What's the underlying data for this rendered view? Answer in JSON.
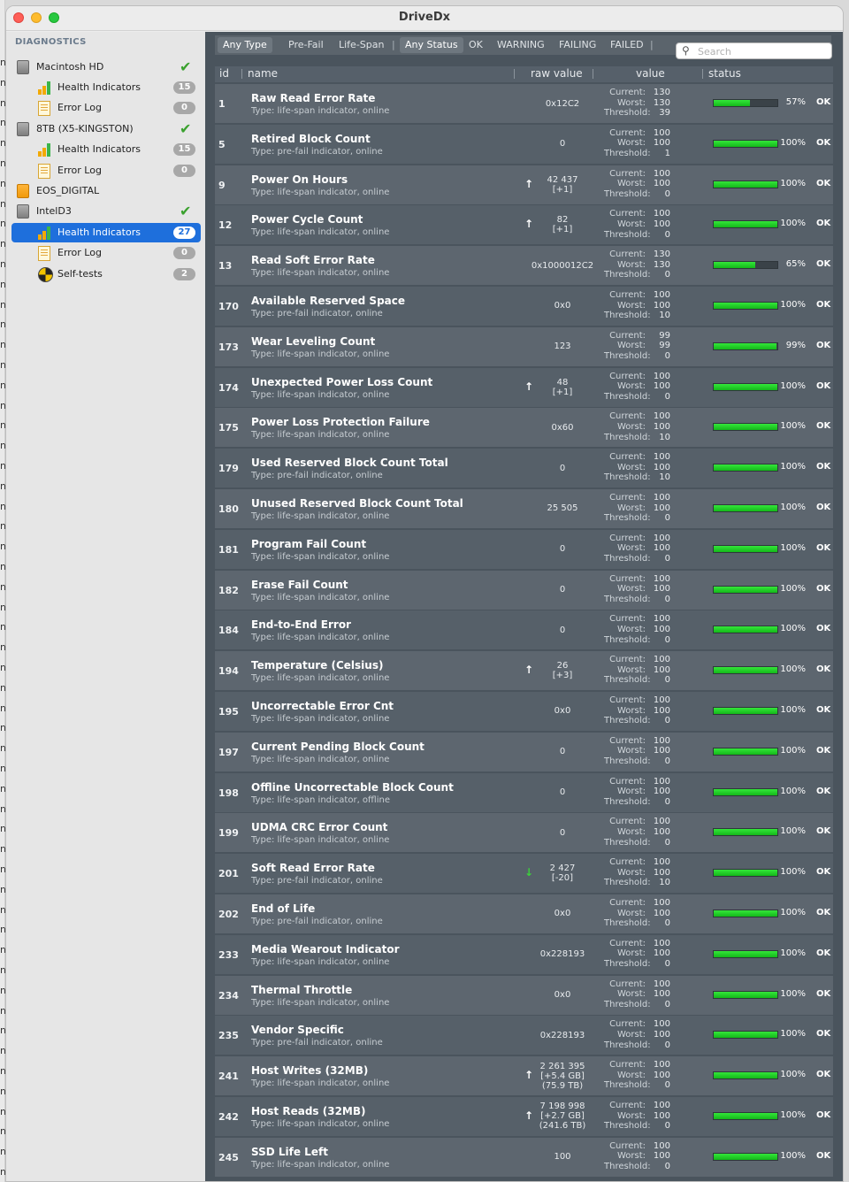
{
  "window": {
    "title": "DriveDx"
  },
  "edge_letters": [
    "n",
    "n",
    "n",
    "n",
    "n",
    "n",
    "n",
    "n",
    "n",
    "n",
    "n",
    "n",
    "n",
    "n",
    "n",
    "n",
    "n",
    "n",
    "n",
    "n",
    "n",
    "n",
    "n",
    "n",
    "n",
    "n",
    "n",
    "n",
    "n",
    "n",
    "n",
    "n",
    "n",
    "n",
    "n",
    "n",
    "n",
    "n",
    "n",
    "n",
    "n",
    "n",
    "n",
    "n",
    "n",
    "n",
    "n",
    "n",
    "n",
    "n",
    "n",
    "n",
    "n",
    "n",
    "n",
    "n",
    "n"
  ],
  "sidebar": {
    "header": "DIAGNOSTICS",
    "items": [
      {
        "label": "Macintosh HD",
        "icon": "disk-icon",
        "check": "✔"
      },
      {
        "label": "Health Indicators",
        "icon": "bar-chart-icon",
        "badge": "15"
      },
      {
        "label": "Error Log",
        "icon": "log-icon",
        "badge": "0"
      },
      {
        "label": "8TB (X5-KINGSTON)",
        "icon": "disk-icon",
        "check": "✔"
      },
      {
        "label": "Health Indicators",
        "icon": "bar-chart-icon",
        "badge": "15"
      },
      {
        "label": "Error Log",
        "icon": "log-icon",
        "badge": "0"
      },
      {
        "label": "EOS_DIGITAL",
        "icon": "disk-icon"
      },
      {
        "label": "IntelD3",
        "icon": "disk-icon",
        "check": "✔"
      },
      {
        "label": "Health Indicators",
        "icon": "bar-chart-icon",
        "badge": "27",
        "selected": true
      },
      {
        "label": "Error Log",
        "icon": "log-icon",
        "badge": "0"
      },
      {
        "label": "Self-tests",
        "icon": "self-test-icon",
        "badge": "2"
      }
    ]
  },
  "filters": {
    "type": [
      "Any Type",
      "Pre-Fail",
      "Life-Span"
    ],
    "status": [
      "Any Status",
      "OK",
      "WARNING",
      "FAILING",
      "FAILED"
    ],
    "sep": "|"
  },
  "search": {
    "placeholder": "Search",
    "icon": "⚲"
  },
  "columns": {
    "id": "id",
    "name": "name",
    "raw": "raw value",
    "value": "value",
    "status": "status"
  },
  "value_labels": {
    "current": "Current:",
    "worst": "Worst:",
    "threshold": "Threshold:"
  },
  "status_colors": {
    "ok": "#14c81a"
  },
  "rows": [
    {
      "id": "1",
      "name": "Raw Read Error Rate",
      "type": "Type: life-span indicator, online",
      "arrow": "",
      "raw": [
        "0x12C2"
      ],
      "current": "130",
      "worst": "130",
      "threshold": "39",
      "pct": 57,
      "pct_label": "57%",
      "status": "OK"
    },
    {
      "id": "5",
      "name": "Retired Block Count",
      "type": "Type: pre-fail indicator, online",
      "arrow": "",
      "raw": [
        "0"
      ],
      "current": "100",
      "worst": "100",
      "threshold": "1",
      "pct": 100,
      "pct_label": "100%",
      "status": "OK"
    },
    {
      "id": "9",
      "name": "Power On Hours",
      "type": "Type: life-span indicator, online",
      "arrow": "↑",
      "raw": [
        "42 437",
        "[+1]"
      ],
      "current": "100",
      "worst": "100",
      "threshold": "0",
      "pct": 100,
      "pct_label": "100%",
      "status": "OK"
    },
    {
      "id": "12",
      "name": "Power Cycle Count",
      "type": "Type: life-span indicator, online",
      "arrow": "↑",
      "raw": [
        "82",
        "[+1]"
      ],
      "current": "100",
      "worst": "100",
      "threshold": "0",
      "pct": 100,
      "pct_label": "100%",
      "status": "OK"
    },
    {
      "id": "13",
      "name": "Read Soft Error Rate",
      "type": "Type: life-span indicator, online",
      "arrow": "",
      "raw": [
        "0x1000012C2"
      ],
      "current": "130",
      "worst": "130",
      "threshold": "0",
      "pct": 65,
      "pct_label": "65%",
      "status": "OK"
    },
    {
      "id": "170",
      "name": "Available Reserved Space",
      "type": "Type: pre-fail indicator, online",
      "arrow": "",
      "raw": [
        "0x0"
      ],
      "current": "100",
      "worst": "100",
      "threshold": "10",
      "pct": 100,
      "pct_label": "100%",
      "status": "OK"
    },
    {
      "id": "173",
      "name": "Wear Leveling Count",
      "type": "Type: life-span indicator, online",
      "arrow": "",
      "raw": [
        "123"
      ],
      "current": "99",
      "worst": "99",
      "threshold": "0",
      "pct": 99,
      "pct_label": "99%",
      "status": "OK"
    },
    {
      "id": "174",
      "name": "Unexpected Power Loss Count",
      "type": "Type: life-span indicator, online",
      "arrow": "↑",
      "raw": [
        "48",
        "[+1]"
      ],
      "current": "100",
      "worst": "100",
      "threshold": "0",
      "pct": 100,
      "pct_label": "100%",
      "status": "OK"
    },
    {
      "id": "175",
      "name": "Power Loss Protection Failure",
      "type": "Type: life-span indicator, online",
      "arrow": "",
      "raw": [
        "0x60"
      ],
      "current": "100",
      "worst": "100",
      "threshold": "10",
      "pct": 100,
      "pct_label": "100%",
      "status": "OK"
    },
    {
      "id": "179",
      "name": "Used Reserved Block Count Total",
      "type": "Type: pre-fail indicator, online",
      "arrow": "",
      "raw": [
        "0"
      ],
      "current": "100",
      "worst": "100",
      "threshold": "10",
      "pct": 100,
      "pct_label": "100%",
      "status": "OK"
    },
    {
      "id": "180",
      "name": "Unused Reserved Block Count Total",
      "type": "Type: life-span indicator, online",
      "arrow": "",
      "raw": [
        "25 505"
      ],
      "current": "100",
      "worst": "100",
      "threshold": "0",
      "pct": 100,
      "pct_label": "100%",
      "status": "OK"
    },
    {
      "id": "181",
      "name": "Program Fail Count",
      "type": "Type: life-span indicator, online",
      "arrow": "",
      "raw": [
        "0"
      ],
      "current": "100",
      "worst": "100",
      "threshold": "0",
      "pct": 100,
      "pct_label": "100%",
      "status": "OK"
    },
    {
      "id": "182",
      "name": "Erase Fail Count",
      "type": "Type: life-span indicator, online",
      "arrow": "",
      "raw": [
        "0"
      ],
      "current": "100",
      "worst": "100",
      "threshold": "0",
      "pct": 100,
      "pct_label": "100%",
      "status": "OK"
    },
    {
      "id": "184",
      "name": "End-to-End Error",
      "type": "Type: life-span indicator, online",
      "arrow": "",
      "raw": [
        "0"
      ],
      "current": "100",
      "worst": "100",
      "threshold": "0",
      "pct": 100,
      "pct_label": "100%",
      "status": "OK"
    },
    {
      "id": "194",
      "name": "Temperature (Celsius)",
      "type": "Type: life-span indicator, online",
      "arrow": "↑",
      "raw": [
        "26",
        "[+3]"
      ],
      "current": "100",
      "worst": "100",
      "threshold": "0",
      "pct": 100,
      "pct_label": "100%",
      "status": "OK"
    },
    {
      "id": "195",
      "name": "Uncorrectable Error Cnt",
      "type": "Type: life-span indicator, online",
      "arrow": "",
      "raw": [
        "0x0"
      ],
      "current": "100",
      "worst": "100",
      "threshold": "0",
      "pct": 100,
      "pct_label": "100%",
      "status": "OK"
    },
    {
      "id": "197",
      "name": "Current Pending Block Count",
      "type": "Type: life-span indicator, online",
      "arrow": "",
      "raw": [
        "0"
      ],
      "current": "100",
      "worst": "100",
      "threshold": "0",
      "pct": 100,
      "pct_label": "100%",
      "status": "OK"
    },
    {
      "id": "198",
      "name": "Offline Uncorrectable Block Count",
      "type": "Type: life-span indicator, offline",
      "arrow": "",
      "raw": [
        "0"
      ],
      "current": "100",
      "worst": "100",
      "threshold": "0",
      "pct": 100,
      "pct_label": "100%",
      "status": "OK"
    },
    {
      "id": "199",
      "name": "UDMA CRC Error Count",
      "type": "Type: life-span indicator, online",
      "arrow": "",
      "raw": [
        "0"
      ],
      "current": "100",
      "worst": "100",
      "threshold": "0",
      "pct": 100,
      "pct_label": "100%",
      "status": "OK"
    },
    {
      "id": "201",
      "name": "Soft Read Error Rate",
      "type": "Type: pre-fail indicator, online",
      "arrow": "↓",
      "raw": [
        "2 427",
        "[-20]"
      ],
      "current": "100",
      "worst": "100",
      "threshold": "10",
      "pct": 100,
      "pct_label": "100%",
      "status": "OK"
    },
    {
      "id": "202",
      "name": "End of Life",
      "type": "Type: pre-fail indicator, online",
      "arrow": "",
      "raw": [
        "0x0"
      ],
      "current": "100",
      "worst": "100",
      "threshold": "0",
      "pct": 100,
      "pct_label": "100%",
      "status": "OK"
    },
    {
      "id": "233",
      "name": "Media Wearout Indicator",
      "type": "Type: life-span indicator, online",
      "arrow": "",
      "raw": [
        "0x228193"
      ],
      "current": "100",
      "worst": "100",
      "threshold": "0",
      "pct": 100,
      "pct_label": "100%",
      "status": "OK"
    },
    {
      "id": "234",
      "name": "Thermal Throttle",
      "type": "Type: life-span indicator, online",
      "arrow": "",
      "raw": [
        "0x0"
      ],
      "current": "100",
      "worst": "100",
      "threshold": "0",
      "pct": 100,
      "pct_label": "100%",
      "status": "OK"
    },
    {
      "id": "235",
      "name": "Vendor Specific",
      "type": "Type: pre-fail indicator, online",
      "arrow": "",
      "raw": [
        "0x228193"
      ],
      "current": "100",
      "worst": "100",
      "threshold": "0",
      "pct": 100,
      "pct_label": "100%",
      "status": "OK"
    },
    {
      "id": "241",
      "name": "Host Writes (32MB)",
      "type": "Type: life-span indicator, online",
      "arrow": "↑",
      "raw": [
        "2 261 395",
        "[+5.4 GB]",
        "(75.9 TB)"
      ],
      "current": "100",
      "worst": "100",
      "threshold": "0",
      "pct": 100,
      "pct_label": "100%",
      "status": "OK"
    },
    {
      "id": "242",
      "name": "Host Reads (32MB)",
      "type": "Type: life-span indicator, online",
      "arrow": "↑",
      "raw": [
        "7 198 998",
        "[+2.7 GB]",
        "(241.6 TB)"
      ],
      "current": "100",
      "worst": "100",
      "threshold": "0",
      "pct": 100,
      "pct_label": "100%",
      "status": "OK"
    },
    {
      "id": "245",
      "name": "SSD Life Left",
      "type": "Type: life-span indicator, online",
      "arrow": "",
      "raw": [
        "100"
      ],
      "current": "100",
      "worst": "100",
      "threshold": "0",
      "pct": 100,
      "pct_label": "100%",
      "status": "OK"
    }
  ]
}
